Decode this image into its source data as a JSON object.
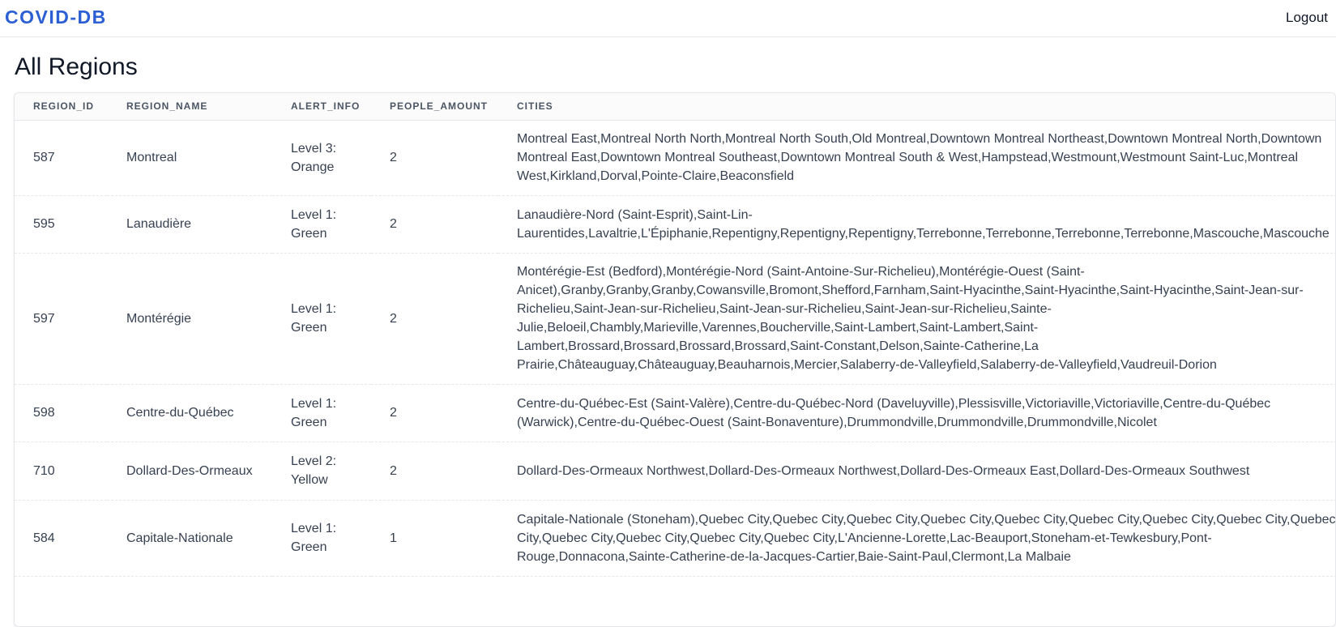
{
  "header": {
    "brand": "COVID-DB",
    "logout_label": "Logout"
  },
  "page": {
    "title": "All Regions"
  },
  "table": {
    "columns": [
      "REGION_ID",
      "REGION_NAME",
      "ALERT_INFO",
      "PEOPLE_AMOUNT",
      "CITIES"
    ],
    "rows": [
      {
        "id": "587",
        "name": "Montreal",
        "alert": "Level 3: Orange",
        "people": "2",
        "cities": "Montreal East,Montreal North North,Montreal North South,Old Montreal,Downtown Montreal Northeast,Downtown Montreal North,Downtown Montreal East,Downtown Montreal Southeast,Downtown Montreal South & West,Hampstead,Westmount,Westmount Saint-Luc,Montreal West,Kirkland,Dorval,Pointe-Claire,Beaconsfield"
      },
      {
        "id": "595",
        "name": "Lanaudière",
        "alert": "Level 1: Green",
        "people": "2",
        "cities": "Lanaudière-Nord (Saint-Esprit),Saint-Lin-Laurentides,Lavaltrie,L'Épiphanie,Repentigny,Repentigny,Repentigny,Terrebonne,Terrebonne,Terrebonne,Terrebonne,Mascouche,Mascouche"
      },
      {
        "id": "597",
        "name": "Montérégie",
        "alert": "Level 1: Green",
        "people": "2",
        "cities": "Montérégie-Est (Bedford),Montérégie-Nord (Saint-Antoine-Sur-Richelieu),Montérégie-Ouest (Saint-Anicet),Granby,Granby,Granby,Cowansville,Bromont,Shefford,Farnham,Saint-Hyacinthe,Saint-Hyacinthe,Saint-Hyacinthe,Saint-Jean-sur-Richelieu,Saint-Jean-sur-Richelieu,Saint-Jean-sur-Richelieu,Saint-Jean-sur-Richelieu,Sainte-Julie,Beloeil,Chambly,Marieville,Varennes,Boucherville,Saint-Lambert,Saint-Lambert,Saint-Lambert,Brossard,Brossard,Brossard,Brossard,Saint-Constant,Delson,Sainte-Catherine,La Prairie,Châteauguay,Châteauguay,Beauharnois,Mercier,Salaberry-de-Valleyfield,Salaberry-de-Valleyfield,Vaudreuil-Dorion"
      },
      {
        "id": "598",
        "name": "Centre-du-Québec",
        "alert": "Level 1: Green",
        "people": "2",
        "cities": "Centre-du-Québec-Est (Saint-Valère),Centre-du-Québec-Nord (Daveluyville),Plessisville,Victoriaville,Victoriaville,Centre-du-Québec (Warwick),Centre-du-Québec-Ouest (Saint-Bonaventure),Drummondville,Drummondville,Drummondville,Nicolet"
      },
      {
        "id": "710",
        "name": "Dollard-Des-Ormeaux",
        "alert": "Level 2: Yellow",
        "people": "2",
        "cities": "Dollard-Des-Ormeaux Northwest,Dollard-Des-Ormeaux Northwest,Dollard-Des-Ormeaux East,Dollard-Des-Ormeaux Southwest"
      },
      {
        "id": "584",
        "name": "Capitale-Nationale",
        "alert": "Level 1: Green",
        "people": "1",
        "cities": "Capitale-Nationale (Stoneham),Quebec City,Quebec City,Quebec City,Quebec City,Quebec City,Quebec City,Quebec City,Quebec City,Quebec City,Quebec City,Quebec City,Quebec City,Quebec City,L'Ancienne-Lorette,Lac-Beauport,Stoneham-et-Tewkesbury,Pont-Rouge,Donnacona,Sainte-Catherine-de-la-Jacques-Cartier,Baie-Saint-Paul,Clermont,La Malbaie"
      }
    ]
  },
  "colors": {
    "brand": "#2c5fd3",
    "border": "#e5e7eb",
    "text": "#374151"
  }
}
